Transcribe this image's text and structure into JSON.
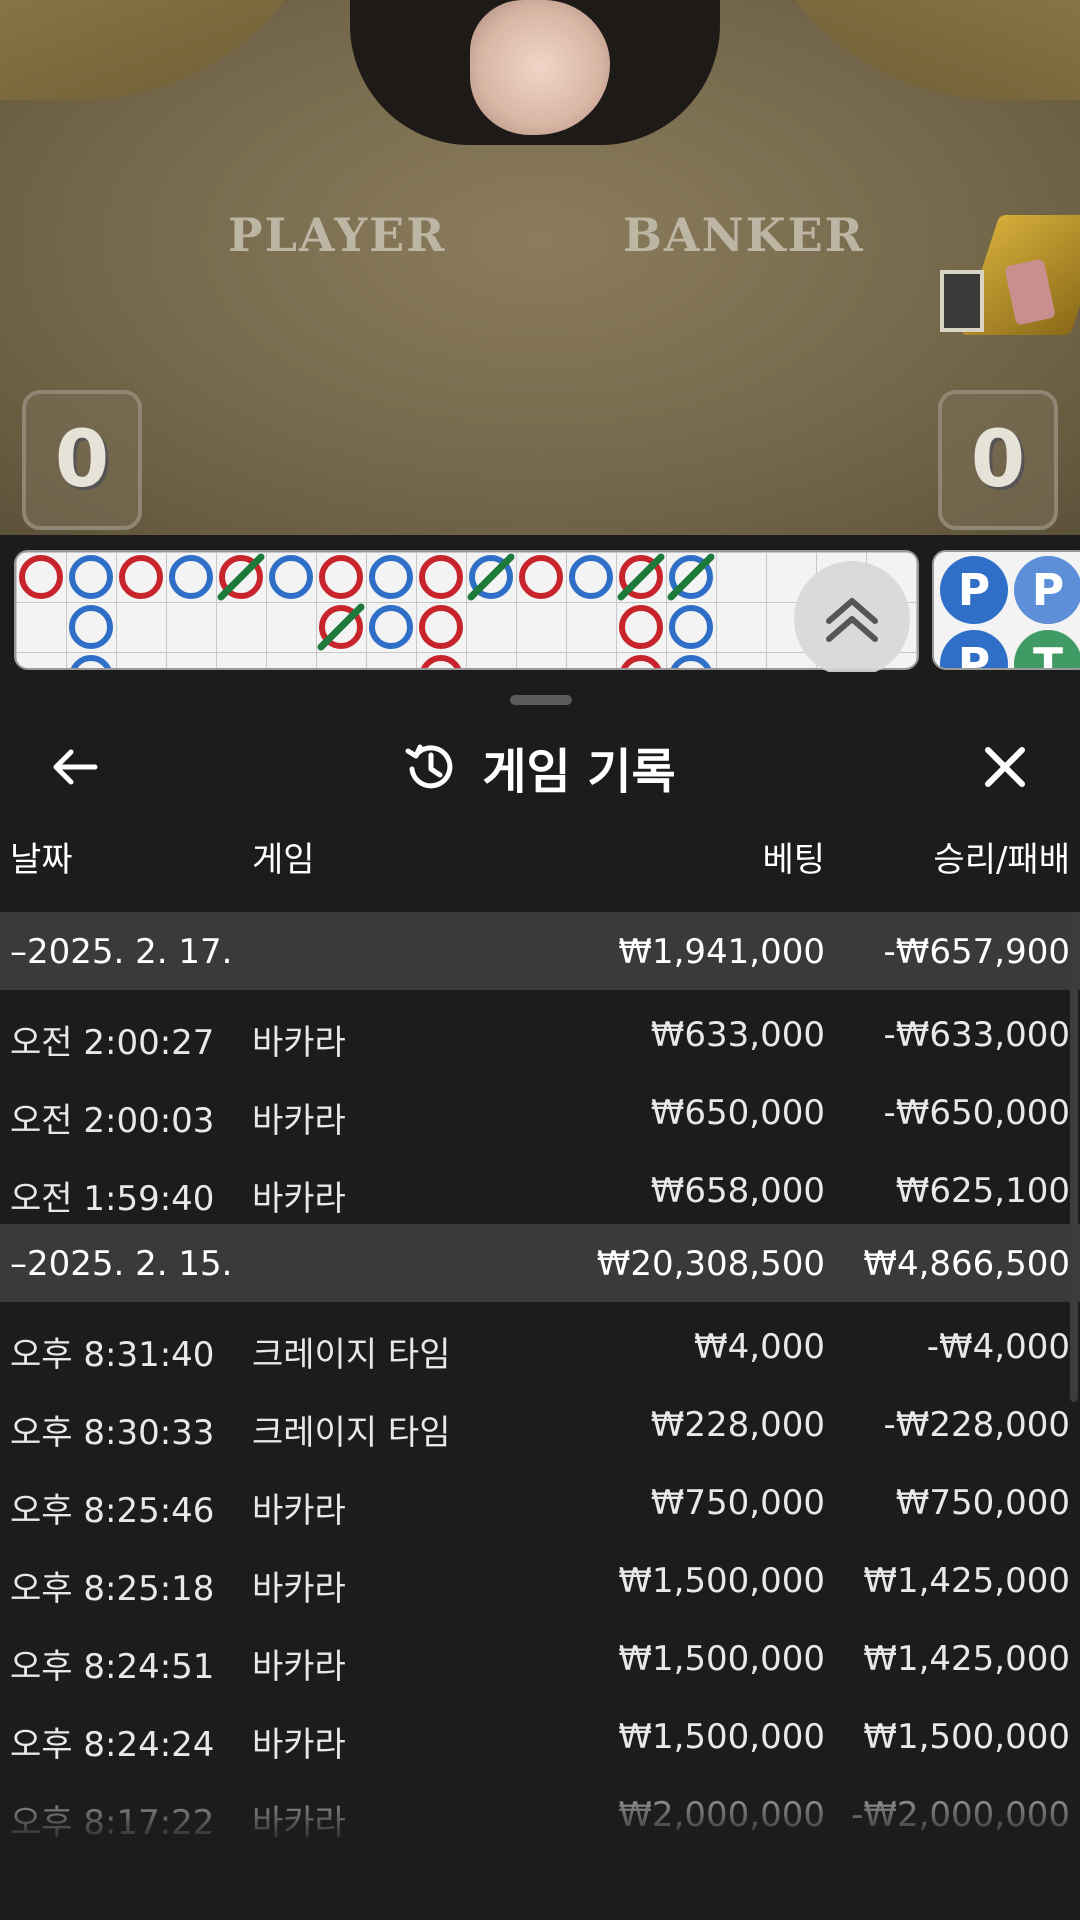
{
  "video": {
    "player_label": "PLAYER",
    "banker_label": "BANKER",
    "player_score": "0",
    "banker_score": "0"
  },
  "sheet": {
    "title": "게임 기록",
    "back_icon": "arrow-left-icon",
    "history_icon": "history-icon",
    "close_icon": "close-icon"
  },
  "columns": {
    "date": "날짜",
    "game": "게임",
    "bet": "베팅",
    "result": "승리/패배"
  },
  "groups": [
    {
      "date": "–2025. 2. 17.",
      "bet": "₩1,941,000",
      "result": "-₩657,900",
      "rows": [
        {
          "time": "오전 2:00:27",
          "game": "바카라",
          "bet": "₩633,000",
          "result": "-₩633,000"
        },
        {
          "time": "오전 2:00:03",
          "game": "바카라",
          "bet": "₩650,000",
          "result": "-₩650,000"
        },
        {
          "time": "오전 1:59:40",
          "game": "바카라",
          "bet": "₩658,000",
          "result": "₩625,100"
        }
      ]
    },
    {
      "date": "–2025. 2. 15.",
      "bet": "₩20,308,500",
      "result": "₩4,866,500",
      "rows": [
        {
          "time": "오후 8:31:40",
          "game": "크레이지 타임",
          "bet": "₩4,000",
          "result": "-₩4,000"
        },
        {
          "time": "오후 8:30:33",
          "game": "크레이지 타임",
          "bet": "₩228,000",
          "result": "-₩228,000"
        },
        {
          "time": "오후 8:25:46",
          "game": "바카라",
          "bet": "₩750,000",
          "result": "₩750,000"
        },
        {
          "time": "오후 8:25:18",
          "game": "바카라",
          "bet": "₩1,500,000",
          "result": "₩1,425,000"
        },
        {
          "time": "오후 8:24:51",
          "game": "바카라",
          "bet": "₩1,500,000",
          "result": "₩1,425,000"
        },
        {
          "time": "오후 8:24:24",
          "game": "바카라",
          "bet": "₩1,500,000",
          "result": "₩1,500,000"
        },
        {
          "time": "오후 8:17:22",
          "game": "바카라",
          "bet": "₩2,000,000",
          "result": "-₩2,000,000"
        }
      ]
    }
  ],
  "road": {
    "colors": {
      "player": "#2f6fc8",
      "banker": "#c8242c",
      "tie": "#1e7a3a"
    },
    "row0": [
      "B",
      "P",
      "B",
      "P",
      "BT",
      "P",
      "B",
      "P",
      "B",
      "PT",
      "B",
      "P",
      "BT",
      "PT"
    ],
    "row1": [
      "",
      "P",
      "",
      "",
      "",
      "",
      "BT",
      "P",
      "B",
      "",
      "",
      "",
      "B",
      "P"
    ],
    "row2": [
      "",
      "P",
      "",
      "",
      "",
      "",
      "",
      "",
      "B",
      "",
      "",
      "",
      "B",
      "P"
    ],
    "side_beads": [
      {
        "label": "P",
        "color": "#2f6fc8"
      },
      {
        "label": "P",
        "color": "#5d8fd8"
      },
      {
        "label": "P",
        "color": "#2f6fc8"
      },
      {
        "label": "T",
        "color": "#3f9a63"
      }
    ]
  }
}
